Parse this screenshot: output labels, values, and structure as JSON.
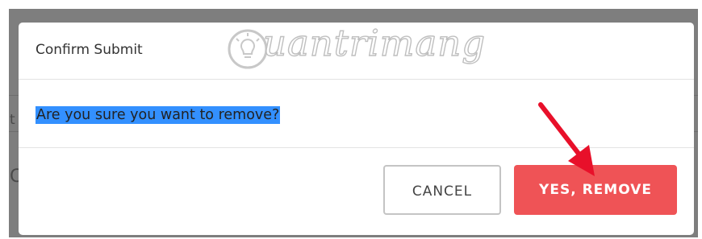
{
  "dialog": {
    "title": "Confirm Submit",
    "message": "Are you sure you want to remove?",
    "cancel_label": "CANCEL",
    "confirm_label": "YES, REMOVE"
  },
  "watermark": {
    "text": "uantrimang"
  },
  "colors": {
    "confirm_button": "#ef5356",
    "selection_highlight": "#3390ff",
    "arrow": "#e8102a",
    "overlay": "#7e7e7e"
  },
  "icons": [
    "lightbulb-icon",
    "annotation-arrow-icon"
  ]
}
